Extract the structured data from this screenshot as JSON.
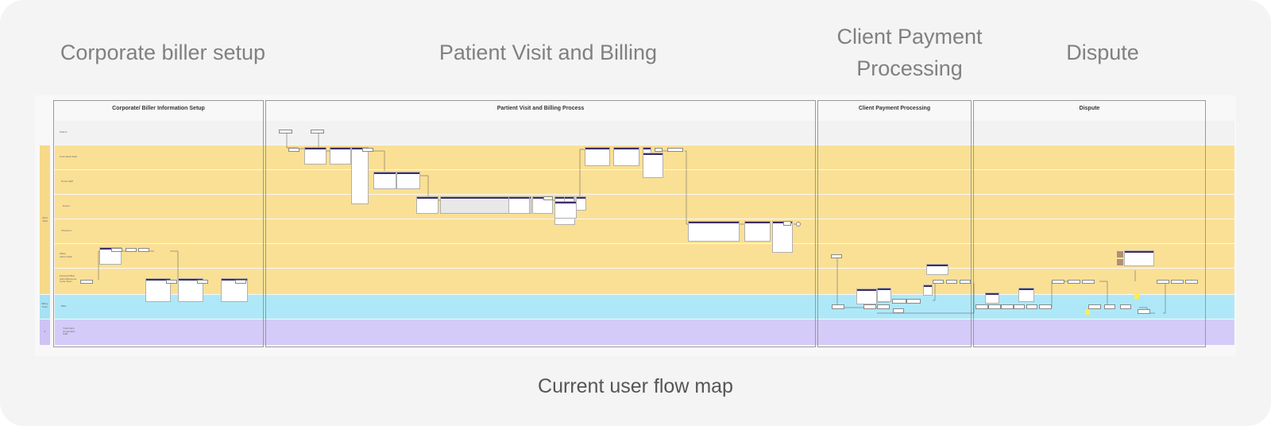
{
  "headings": {
    "corporate": "Corporate biller setup",
    "patient": "Patient Visit and Billing",
    "client_line1": "Client Payment",
    "client_line2": "Processing",
    "dispute": "Dispute"
  },
  "caption": "Current user flow map",
  "frames": {
    "corporate": "Corporate/ Biller Information Setup",
    "patient": "Partient Visit and Billing Process",
    "client": "Client Payment Processing",
    "dispute": "Dispute"
  },
  "lanes": {
    "patient": "Patient",
    "front_desk": "Front Desk Staff",
    "nurse": "Nurse Staff",
    "doctor": "Doctor",
    "checkout": "Checkout",
    "admin": "Office Admin Staff",
    "finance": "Finance/Office Admin/Revenue Cycle Team",
    "biller": "Biller",
    "third_party": "Third Party Corporation Staff"
  },
  "groups": {
    "clinic": "Clinic Staff",
    "billing": "Billing Team",
    "other": "3"
  }
}
